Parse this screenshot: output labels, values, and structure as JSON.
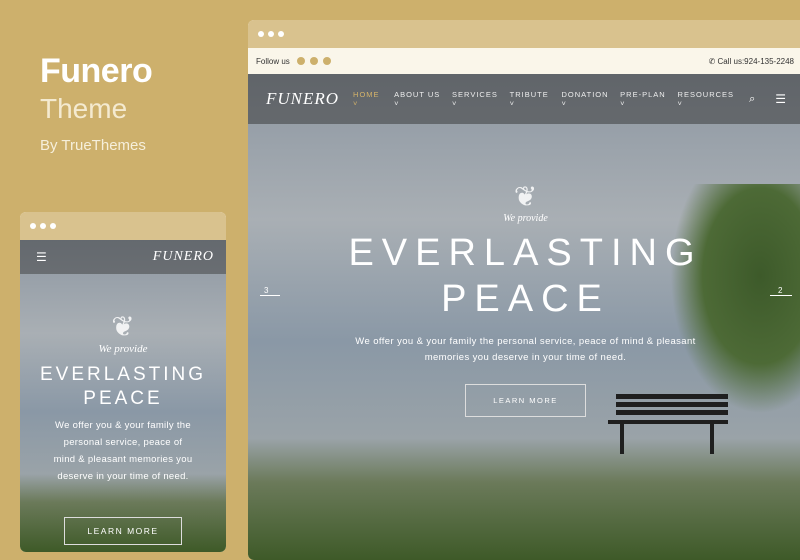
{
  "promo": {
    "title": "Funero",
    "subtitle": "Theme",
    "author": "By TrueThemes"
  },
  "desktop": {
    "topbar": {
      "follow": "Follow us",
      "call": "Call us:924-135-2248"
    },
    "logo": "FUNERO",
    "nav": [
      {
        "label": "HOME",
        "active": true
      },
      {
        "label": "ABOUT US"
      },
      {
        "label": "SERVICES"
      },
      {
        "label": "TRIBUTE"
      },
      {
        "label": "DONATION"
      },
      {
        "label": "PRE-PLAN"
      },
      {
        "label": "RESOURCES"
      }
    ],
    "hero": {
      "kicker": "We provide",
      "line1": "EVERLASTING",
      "line2": "PEACE",
      "desc1": "We offer you & your family the personal service, peace of mind & pleasant",
      "desc2": "memories you deserve in your time of need.",
      "button": "LEARN MORE",
      "prev": "3",
      "next": "2"
    }
  },
  "mobile": {
    "logo": "FUNERO",
    "kicker": "We provide",
    "line1": "EVERLASTING",
    "line2": "PEACE",
    "desc": [
      "We offer you & your family the",
      "personal service, peace of",
      "mind & pleasant memories you",
      "deserve in your time of need."
    ],
    "button": "LEARN MORE"
  },
  "colors": {
    "background": "#cdb06c",
    "accent": "#d4b36a"
  }
}
